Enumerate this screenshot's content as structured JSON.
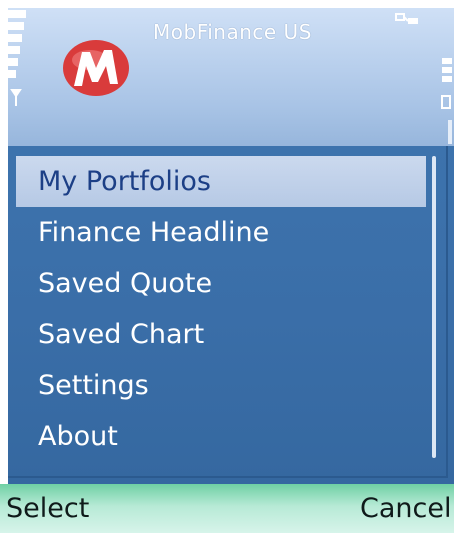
{
  "status_bar": {
    "app_title": "MobFinance US",
    "signal_icon": "signal-strength-icon",
    "battery_icon": "battery-level-icon",
    "connection_icon": "data-connection-icon",
    "logo": "mobfinance-logo"
  },
  "menu": {
    "items": [
      {
        "label": "My Portfolios",
        "selected": true
      },
      {
        "label": "Finance Headline",
        "selected": false
      },
      {
        "label": "Saved Quote",
        "selected": false
      },
      {
        "label": "Saved Chart",
        "selected": false
      },
      {
        "label": "Settings",
        "selected": false
      },
      {
        "label": "About",
        "selected": false
      }
    ]
  },
  "softkeys": {
    "left": "Select",
    "right": "Cancel"
  },
  "colors": {
    "menu_background": "#3a6ea8",
    "selection_highlight": "#c4d5ec",
    "selected_text": "#1c3f86",
    "softkey_bar": "#b7ead6",
    "logo_red": "#d93b3b"
  }
}
